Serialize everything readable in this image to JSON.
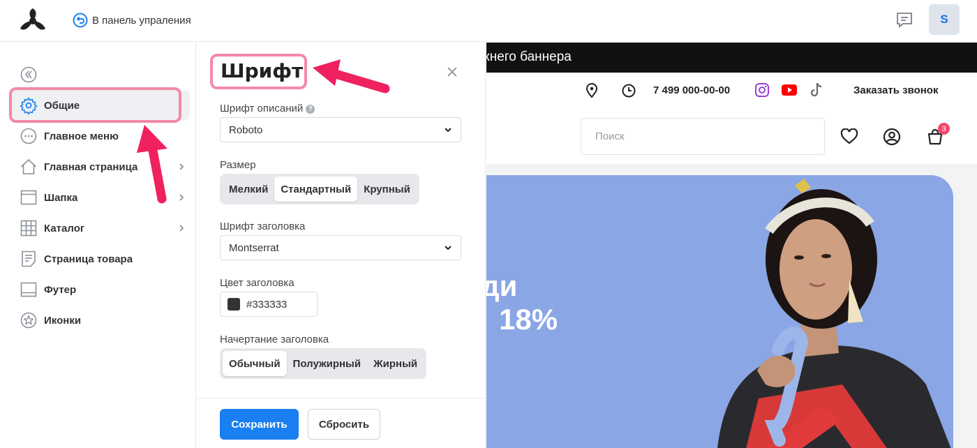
{
  "topbar": {
    "back_label": "В панель упраления",
    "avatar_letter": "S"
  },
  "nav": {
    "items": [
      {
        "label": "Общие",
        "icon": "gear-icon",
        "active": true
      },
      {
        "label": "Главное меню",
        "icon": "dots-circle-icon"
      },
      {
        "label": "Главная страница",
        "icon": "home-icon",
        "chevron": true
      },
      {
        "label": "Шапка",
        "icon": "header-layout-icon",
        "chevron": true
      },
      {
        "label": "Каталог",
        "icon": "grid-icon",
        "chevron": true
      },
      {
        "label": "Страница товара",
        "icon": "document-icon"
      },
      {
        "label": "Футер",
        "icon": "footer-layout-icon"
      },
      {
        "label": "Иконки",
        "icon": "star-circle-icon"
      }
    ]
  },
  "panel": {
    "title": "Шрифт",
    "desc_font_label": "Шрифт описаний",
    "desc_font_value": "Roboto",
    "size_label": "Размер",
    "size_options": [
      "Мелкий",
      "Стандартный",
      "Крупный"
    ],
    "size_selected": "Стандартный",
    "heading_font_label": "Шрифт заголовка",
    "heading_font_value": "Montserrat",
    "heading_color_label": "Цвет заголовка",
    "heading_color_value": "#333333",
    "heading_style_label": "Начертание заголовка",
    "heading_style_options": [
      "Обычный",
      "Полужирный",
      "Жирный"
    ],
    "heading_style_selected": "Обычный",
    "save_label": "Сохранить",
    "reset_label": "Сбросить"
  },
  "preview": {
    "announcement": "жнего баннера",
    "phone": "7 499 000-00-00",
    "callback": "Заказать звонок",
    "search_placeholder": "Поиск",
    "cart_count": "3",
    "banner_line1": "ди",
    "banner_line2": "18%"
  },
  "colors": {
    "accent": "#1a7ff0",
    "highlight": "#f38aa8",
    "arrow": "#f0215f",
    "banner_bg": "#8aa6e4"
  }
}
